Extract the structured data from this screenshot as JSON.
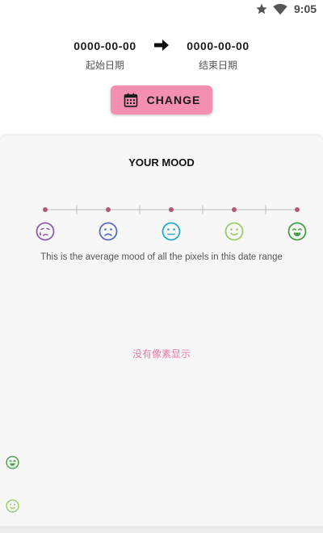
{
  "status_bar": {
    "time": "9:05",
    "icons": [
      "star-icon",
      "wifi-icon"
    ]
  },
  "date_range": {
    "start_date": "0000-00-00",
    "start_label": "起始日期",
    "end_date": "0000-00-00",
    "end_label": "结束日期",
    "arrow_icon": "arrow-right-icon"
  },
  "change_button": {
    "label": "CHANGE",
    "icon": "calendar-icon",
    "color": "#f48fb1"
  },
  "mood_card": {
    "title": "YOUR MOOD",
    "average_text": "This is the average mood of all the pixels in this date range",
    "empty_text": "没有像素显示",
    "moods": [
      {
        "name": "very-sad",
        "icon": "crying-face-icon",
        "color": "#8e5fa8"
      },
      {
        "name": "sad",
        "icon": "frowning-face-icon",
        "color": "#5c6bc0"
      },
      {
        "name": "neutral",
        "icon": "neutral-face-icon",
        "color": "#26a9c8"
      },
      {
        "name": "happy",
        "icon": "smiling-face-icon",
        "color": "#9ccc65"
      },
      {
        "name": "very-happy",
        "icon": "grinning-face-icon",
        "color": "#43a047"
      }
    ],
    "slider_color": "#b05a7a",
    "side_faces": [
      {
        "icon": "grinning-face-icon",
        "color": "#43a047"
      },
      {
        "icon": "smiling-face-icon",
        "color": "#9ccc65"
      }
    ]
  }
}
